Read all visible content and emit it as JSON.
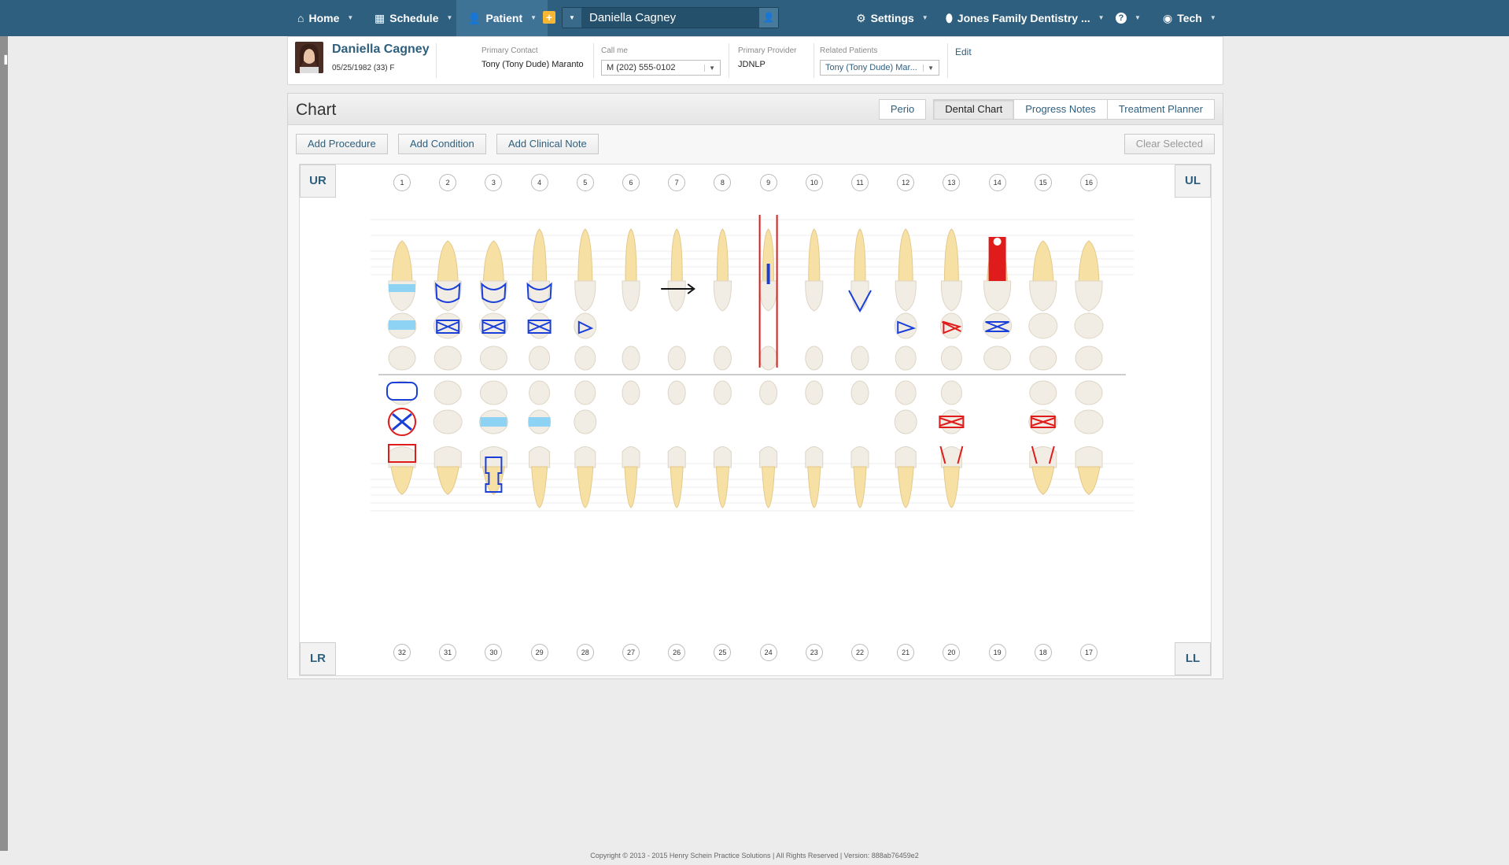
{
  "nav": {
    "home": "Home",
    "schedule": "Schedule",
    "patient": "Patient",
    "search_value": "Daniella Cagney",
    "settings": "Settings",
    "location": "Jones Family Dentistry ...",
    "help": "?",
    "user": "Tech"
  },
  "patient": {
    "name": "Daniella Cagney",
    "dob": "05/25/1982 (33) F",
    "primary_contact_label": "Primary Contact",
    "primary_contact": "Tony (Tony Dude) Maranto",
    "call_me_label": "Call me",
    "call_me": "M (202) 555-0102",
    "primary_provider_label": "Primary Provider",
    "primary_provider": "JDNLP",
    "related_label": "Related Patients",
    "related": "Tony (Tony Dude) Mar...",
    "edit": "Edit"
  },
  "chart": {
    "title": "Chart",
    "tabs": [
      "Perio",
      "Dental Chart",
      "Progress Notes",
      "Treatment Planner"
    ],
    "selected_tab": "Dental Chart",
    "buttons": {
      "add_procedure": "Add Procedure",
      "add_condition": "Add Condition",
      "add_clinical_note": "Add Clinical Note",
      "clear_selected": "Clear Selected"
    },
    "quadrants": {
      "ur": "UR",
      "ul": "UL",
      "lr": "LR",
      "ll": "LL"
    },
    "upper_numbers": [
      "1",
      "2",
      "3",
      "4",
      "5",
      "6",
      "7",
      "8",
      "9",
      "10",
      "11",
      "12",
      "13",
      "14",
      "15",
      "16"
    ],
    "lower_numbers": [
      "32",
      "31",
      "30",
      "29",
      "28",
      "27",
      "26",
      "25",
      "24",
      "23",
      "22",
      "21",
      "20",
      "19",
      "18",
      "17"
    ]
  },
  "colors": {
    "nav": "#2e5f7e",
    "tooth": "#f6e0a4",
    "crown": "#f1ede4",
    "existing": "#1a3fd9",
    "planned": "#e01b1b",
    "sealant": "#8fd3f4"
  },
  "footer": "Copyright © 2013 - 2015 Henry Schein Practice Solutions | All Rights Reserved | Version: 888ab76459e2"
}
